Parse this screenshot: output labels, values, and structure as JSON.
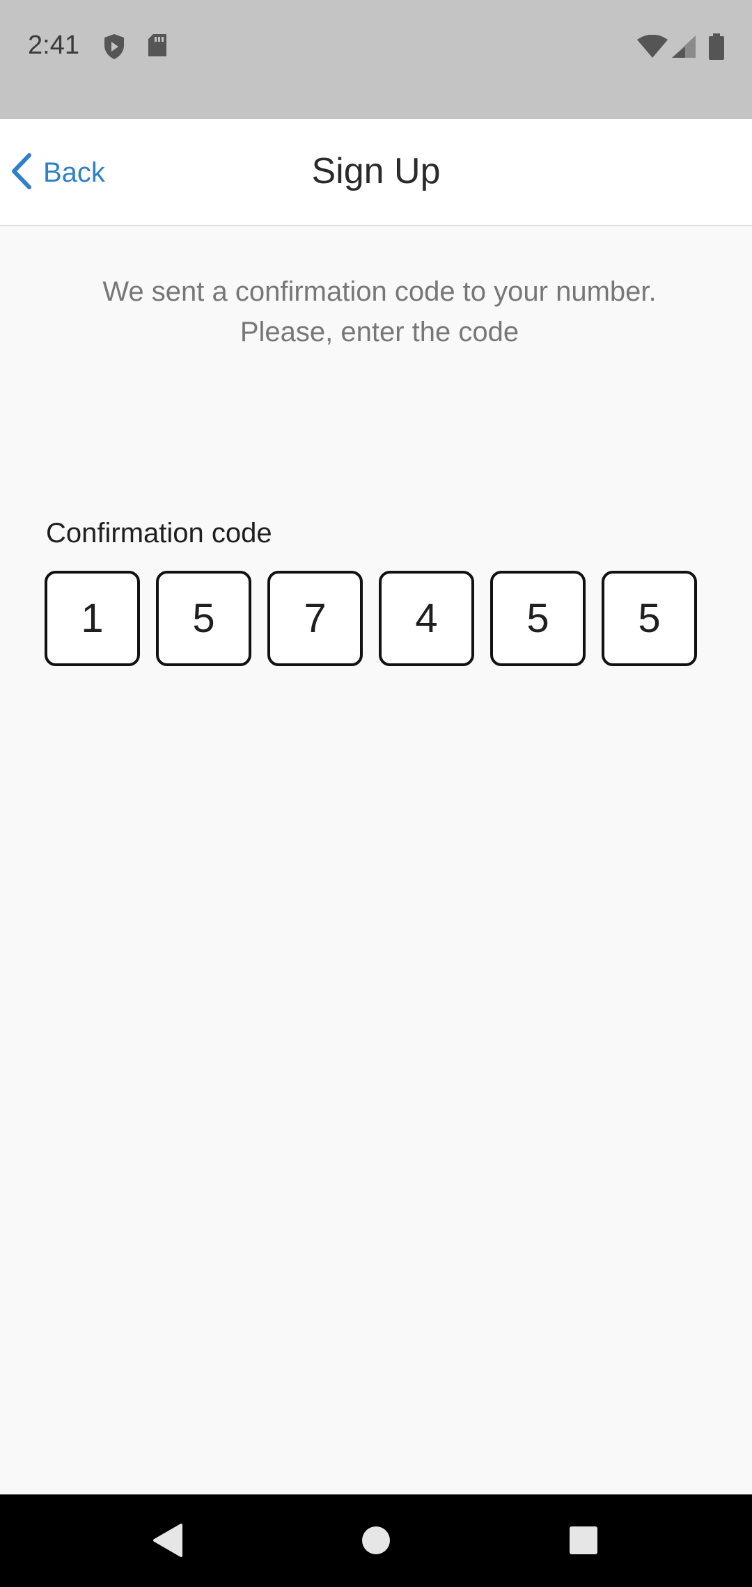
{
  "status_bar": {
    "time": "2:41",
    "icons": [
      "shield-icon",
      "sd-card-icon",
      "wifi-icon",
      "signal-icon",
      "battery-icon"
    ]
  },
  "header": {
    "back_label": "Back",
    "title": "Sign Up"
  },
  "main": {
    "instruction_line1": "We sent a confirmation code to your number.",
    "instruction_line2": "Please, enter the code",
    "code_label": "Confirmation code",
    "code_digits": [
      "1",
      "5",
      "7",
      "4",
      "5",
      "5"
    ]
  },
  "nav_bar": {
    "buttons": [
      "back-nav-icon",
      "home-nav-icon",
      "recents-nav-icon"
    ]
  },
  "colors": {
    "accent": "#2f80c8",
    "status_bar": "#c4c4c4",
    "background": "#f9f9f9",
    "nav_bar": "#000000"
  }
}
